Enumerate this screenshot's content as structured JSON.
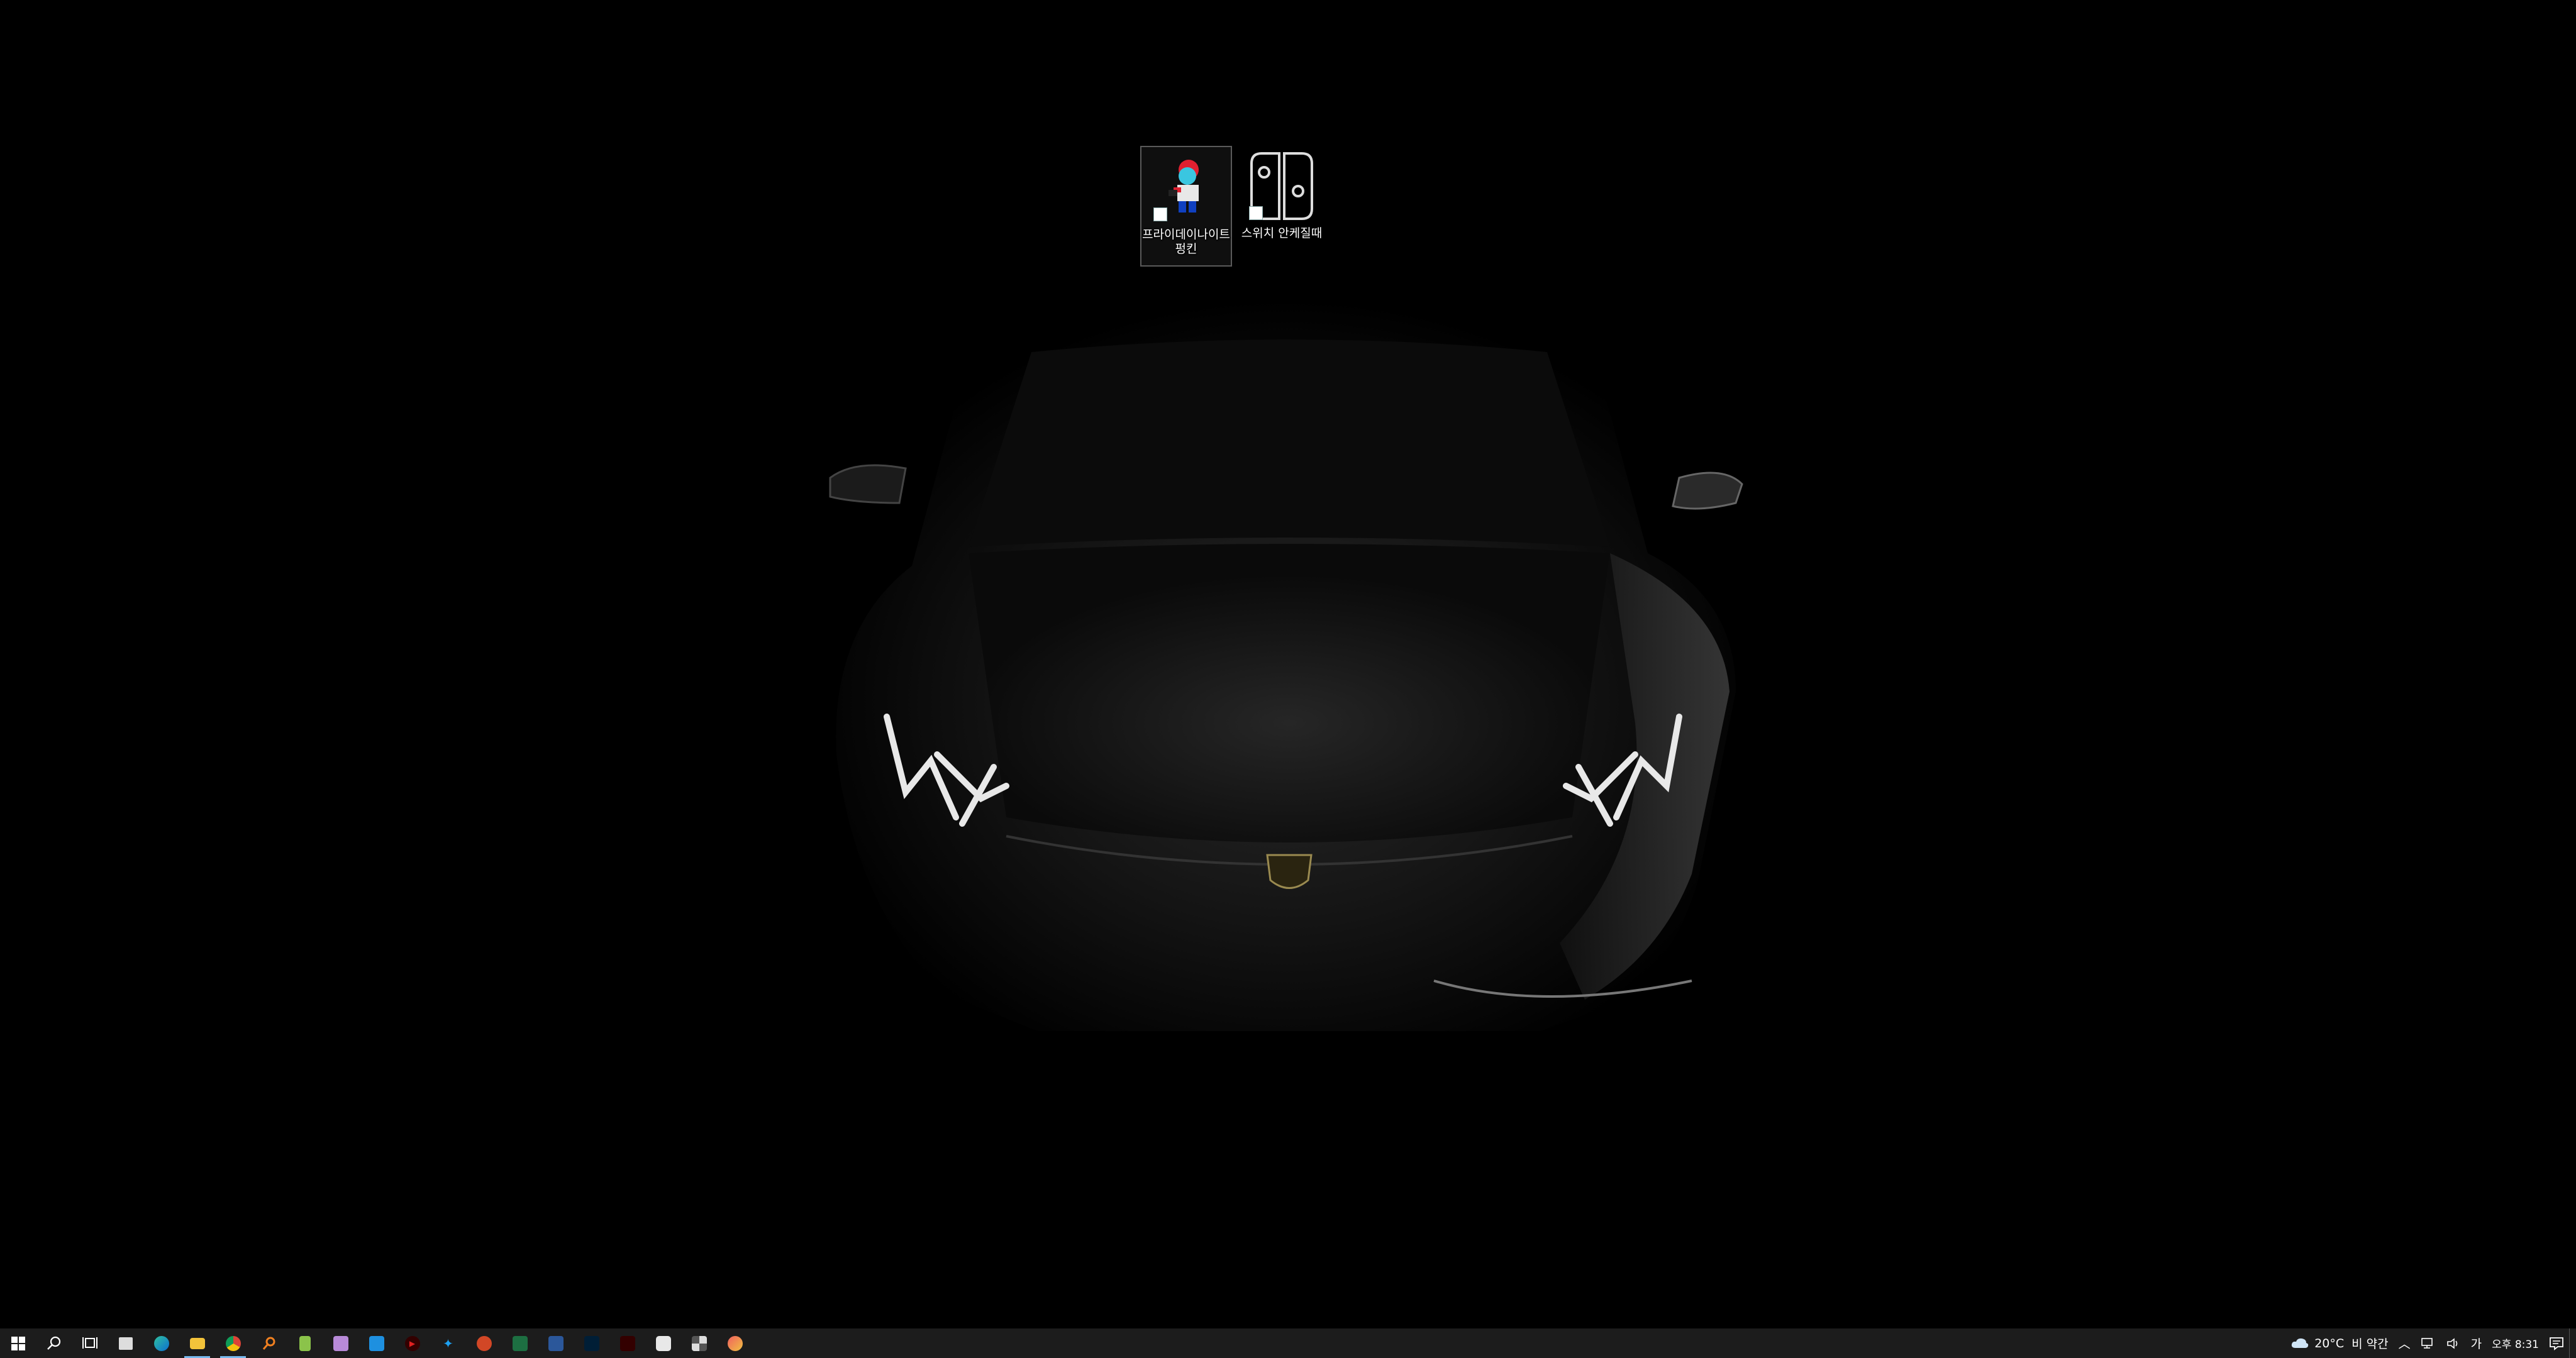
{
  "desktop": {
    "icons": [
      {
        "label": "프라이데이나이트 펑킨",
        "icon": "friday-night-funkin-icon",
        "selected": true
      },
      {
        "label": "스위치 안케질때",
        "icon": "nintendo-switch-icon",
        "selected": false
      }
    ],
    "wallpaper": "black sports car"
  },
  "taskbar": {
    "apps": [
      {
        "name": "start-button",
        "icon": "windows-logo-icon"
      },
      {
        "name": "search-button",
        "icon": "search-icon"
      },
      {
        "name": "task-view-button",
        "icon": "task-view-icon"
      },
      {
        "name": "microsoft-store-button",
        "icon": "store-bag-icon"
      },
      {
        "name": "edge-button",
        "icon": "edge-icon"
      },
      {
        "name": "file-explorer-button",
        "icon": "folder-icon",
        "active": true
      },
      {
        "name": "chrome-button",
        "icon": "chrome-icon",
        "active": true
      },
      {
        "name": "search-tool-button",
        "icon": "magnifier-orange-icon"
      },
      {
        "name": "notepad-button",
        "icon": "notepad-icon"
      },
      {
        "name": "calendar-app-button",
        "icon": "calendar-icon"
      },
      {
        "name": "blue-app-button",
        "icon": "blue-app-icon"
      },
      {
        "name": "media-player-button",
        "icon": "media-player-icon"
      },
      {
        "name": "twitter-button",
        "icon": "twitter-bird-icon"
      },
      {
        "name": "powerpoint-button",
        "icon": "powerpoint-icon"
      },
      {
        "name": "excel-button",
        "icon": "excel-icon"
      },
      {
        "name": "word-button",
        "icon": "word-icon"
      },
      {
        "name": "photoshop-button",
        "icon": "photoshop-icon"
      },
      {
        "name": "illustrator-button",
        "icon": "illustrator-icon"
      },
      {
        "name": "capture-tool-button",
        "icon": "camera-icon"
      },
      {
        "name": "puzzle-app-button",
        "icon": "puzzle-icon"
      },
      {
        "name": "paint-app-button",
        "icon": "paint-icon"
      }
    ],
    "tray": {
      "temperature": "20°C",
      "weather": "비 약간",
      "ime": "가",
      "time": "오후 8:31"
    }
  },
  "colors": {
    "taskbar_bg": "#1c1c1c",
    "accent": "#76b9ed"
  }
}
